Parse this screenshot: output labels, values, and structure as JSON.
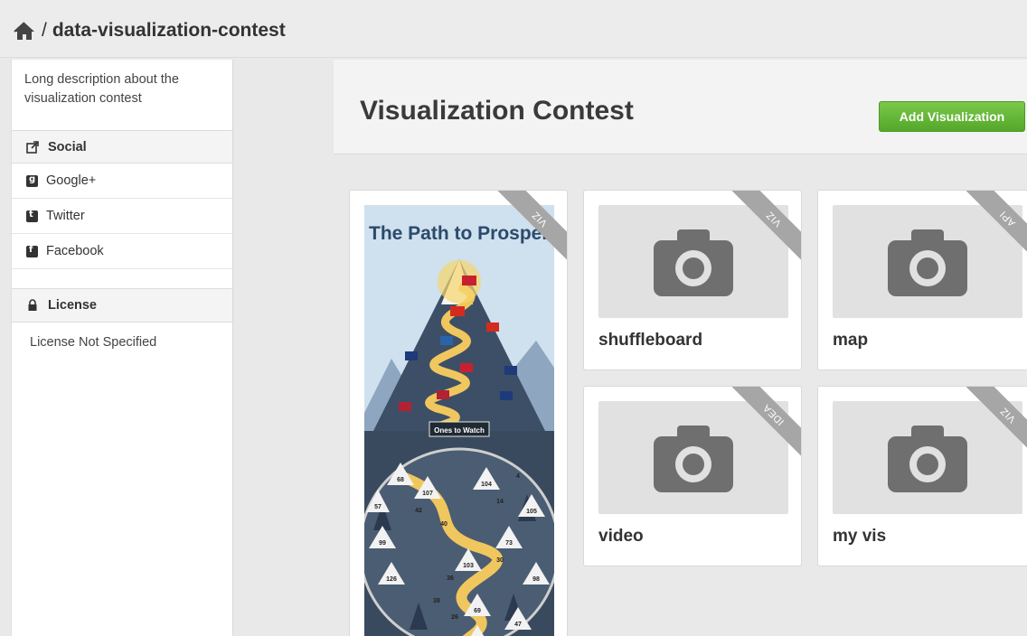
{
  "breadcrumb": {
    "separator": "/",
    "project": "data-visualization-contest"
  },
  "sidebar": {
    "description": "Long description about the visualization contest",
    "social_heading": "Social",
    "social_items": [
      {
        "label": "Google+",
        "icon": "google-plus-icon"
      },
      {
        "label": "Twitter",
        "icon": "twitter-icon"
      },
      {
        "label": "Facebook",
        "icon": "facebook-icon"
      }
    ],
    "license_heading": "License",
    "license_text": "License Not Specified"
  },
  "header": {
    "title": "Visualization Contest",
    "add_button": "Add Visualization"
  },
  "cards": [
    {
      "name": "",
      "tag": "VIZ",
      "thumbnail": "infographic-poster"
    },
    {
      "name": "shuffleboard",
      "tag": "VIZ",
      "thumbnail": "camera-icon"
    },
    {
      "name": "map",
      "tag": "API",
      "thumbnail": "camera-icon"
    },
    {
      "name": "video",
      "tag": "IDEA",
      "thumbnail": "camera-icon"
    },
    {
      "name": "my vis",
      "tag": "VIZ",
      "thumbnail": "camera-icon"
    }
  ],
  "poster": {
    "title": "The Path to Prosperity",
    "section_label": "Ones to Watch",
    "tent_numbers": [
      "68",
      "107",
      "57",
      "104",
      "105",
      "99",
      "103",
      "73",
      "126",
      "98",
      "69",
      "47",
      "60",
      "42",
      "40",
      "30",
      "36",
      "38",
      "14",
      "4",
      "26"
    ]
  },
  "colors": {
    "accent_green": "#5cb130",
    "ribbon_gray": "#a6a6a6",
    "thumb_bg": "#e1e1e1",
    "camera_gray": "#6f6f6f"
  }
}
